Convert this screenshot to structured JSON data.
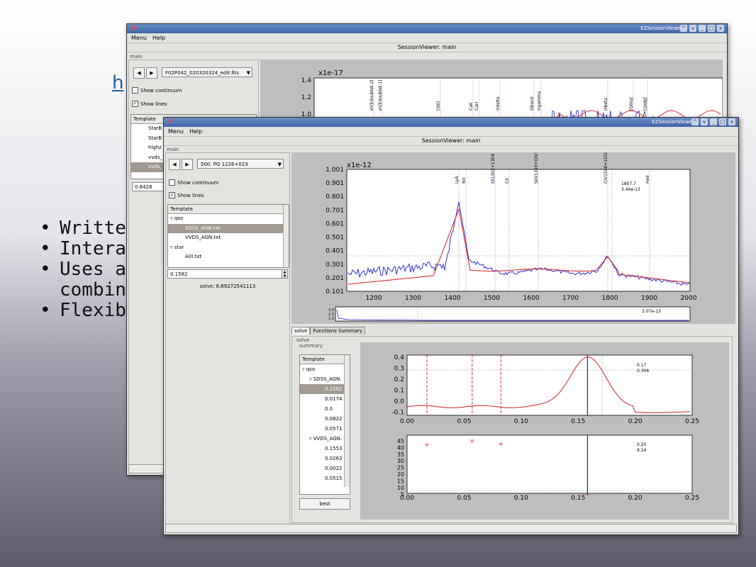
{
  "slide": {
    "link_text": "h",
    "bullets": [
      "Writte",
      "Intera",
      "Uses a",
      "combin",
      "Flexib"
    ]
  },
  "back_window": {
    "title": "EZSessionViewer",
    "menu": [
      "Menu",
      "Help"
    ],
    "caption": "SessionViewer: main",
    "group_label": "main",
    "combo_value": "F02P042_020320324_edit.fits",
    "show_continuum": "Show continuum",
    "show_lines": "Show lines",
    "template_header": "Template",
    "template_items": [
      "StarB",
      "StarB",
      "highz",
      "vvds_",
      "vvds_"
    ],
    "value_field": "0.8428",
    "plot": {
      "multiplier": "x1e-17",
      "y_ticks": [
        "1.4",
        "1.2",
        "1.0"
      ],
      "line_labels": [
        "eV](doublet-2)",
        "eV](doublet-1)",
        "[OII]",
        "CaK",
        "CaH",
        "Hdelta",
        "Gband",
        "Hgamma",
        "Hbeta",
        "[OIIIa]",
        "[OIIIb]"
      ]
    }
  },
  "front_window": {
    "title": "EZSessionViewer",
    "menu": [
      "Menu",
      "Help"
    ],
    "caption": "SessionViewer: main",
    "group_label": "main",
    "combo_value": "500. PG 1226+023",
    "show_continuum": "Show continuum",
    "show_lines": "Show lines",
    "template_header": "Template",
    "template_tree": [
      {
        "label": "qso",
        "type": "group"
      },
      {
        "label": "SDSS_AGN.txt",
        "type": "item",
        "selected": true
      },
      {
        "label": "VVDS_AGN.txt",
        "type": "item"
      },
      {
        "label": "star",
        "type": "group"
      },
      {
        "label": "A0I.txt",
        "type": "item"
      }
    ],
    "redshift_value": "0.1582",
    "solve_text": "solve: 6.69272541113",
    "spectrum": {
      "multiplier": "x1e-12",
      "y_ticks": [
        "1.001",
        "0.901",
        "0.801",
        "0.701",
        "0.601",
        "0.501",
        "0.401",
        "0.301",
        "0.201",
        "0.101"
      ],
      "x_ticks": [
        "1200",
        "1300",
        "1400",
        "1500",
        "1600",
        "1700",
        "1800",
        "1900",
        "2000"
      ],
      "line_labels": [
        "LyA",
        "NV",
        "OI1302+1304",
        "CII",
        "SiIV1393+OIV1402",
        "CIV1548+1550",
        "HeII"
      ],
      "cursor_readout": [
        "1807.7",
        "3.44e-13"
      ]
    },
    "mini_plot": {
      "cursor_readout": "3.07e-13"
    },
    "tabs": [
      "solve",
      "Functions Summary"
    ],
    "solve_group_label": "solve",
    "summary_group_label": "summary",
    "summary_header": "Template",
    "summary_tree": [
      {
        "label": "qso",
        "indent": 0
      },
      {
        "label": "SDSS_AGN.",
        "indent": 1
      },
      {
        "label": "0.1582",
        "indent": 2,
        "selected": true
      },
      {
        "label": "0.0174",
        "indent": 2
      },
      {
        "label": "0.0",
        "indent": 2
      },
      {
        "label": "0.0822",
        "indent": 2
      },
      {
        "label": "0.0571",
        "indent": 2
      },
      {
        "label": "VVDS_AGN.",
        "indent": 1
      },
      {
        "label": "0.1553",
        "indent": 2
      },
      {
        "label": "0.0263",
        "indent": 2
      },
      {
        "label": "0.0022",
        "indent": 2
      },
      {
        "label": "0.0515",
        "indent": 2
      }
    ],
    "best_button": "best",
    "corr_plot": {
      "y_ticks": [
        "0.4",
        "0.3",
        "0.2",
        "0.1",
        "0.0",
        "-0.1"
      ],
      "x_ticks": [
        "0.00",
        "0.05",
        "0.10",
        "0.15",
        "0.20",
        "0.25"
      ],
      "readout": [
        "0.17",
        "0.306"
      ]
    },
    "chi_plot": {
      "y_ticks": [
        "45",
        "40",
        "35",
        "30",
        "25",
        "20",
        "15",
        "10",
        "5"
      ],
      "x_ticks": [
        "0.00",
        "0.05",
        "0.10",
        "0.15",
        "0.20",
        "0.25"
      ],
      "readout": [
        "0.25",
        "8.24"
      ]
    }
  },
  "colors": {
    "spectrum_blue": "#1a1ad0",
    "model_red": "#d02020",
    "line_marker": "#c050d0"
  }
}
